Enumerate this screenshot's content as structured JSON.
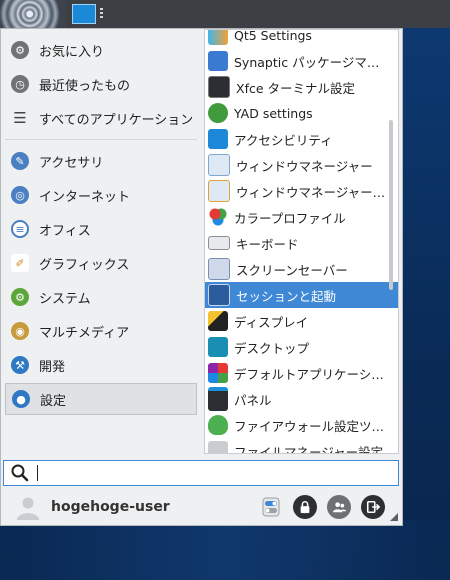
{
  "categories": [
    {
      "label": "お気に入り",
      "icon": "gear-icon"
    },
    {
      "label": "最近使ったもの",
      "icon": "clock-icon"
    },
    {
      "label": "すべてのアプリケーション",
      "icon": "list-icon"
    },
    {
      "label": "アクセサリ",
      "icon": "brush-icon"
    },
    {
      "label": "インターネット",
      "icon": "globe-icon"
    },
    {
      "label": "オフィス",
      "icon": "document-icon"
    },
    {
      "label": "グラフィックス",
      "icon": "pencil-icon"
    },
    {
      "label": "システム",
      "icon": "gear-icon"
    },
    {
      "label": "マルチメディア",
      "icon": "speaker-icon"
    },
    {
      "label": "開発",
      "icon": "hammer-icon"
    },
    {
      "label": "設定",
      "icon": "toggle-icon"
    }
  ],
  "apps": [
    {
      "label": "Qt5 Settings"
    },
    {
      "label": "Synaptic パッケージマ…"
    },
    {
      "label": "Xfce ターミナル設定"
    },
    {
      "label": "YAD settings"
    },
    {
      "label": "アクセシビリティ"
    },
    {
      "label": "ウィンドウマネージャー"
    },
    {
      "label": "ウィンドウマネージャー…"
    },
    {
      "label": "カラープロファイル"
    },
    {
      "label": "キーボード"
    },
    {
      "label": "スクリーンセーバー"
    },
    {
      "label": "セッションと起動"
    },
    {
      "label": "ディスプレイ"
    },
    {
      "label": "デスクトップ"
    },
    {
      "label": "デフォルトアプリケーシ…"
    },
    {
      "label": "パネル"
    },
    {
      "label": "ファイアウォール設定ツ…"
    },
    {
      "label": "ファイルマネージャー設定"
    }
  ],
  "search": {
    "value": "",
    "placeholder": ""
  },
  "user": {
    "name": "hogehoge-user"
  },
  "colors": {
    "accent": "#3e88d6",
    "panel": "#3c3f43",
    "menu_bg": "#eef0f2"
  }
}
